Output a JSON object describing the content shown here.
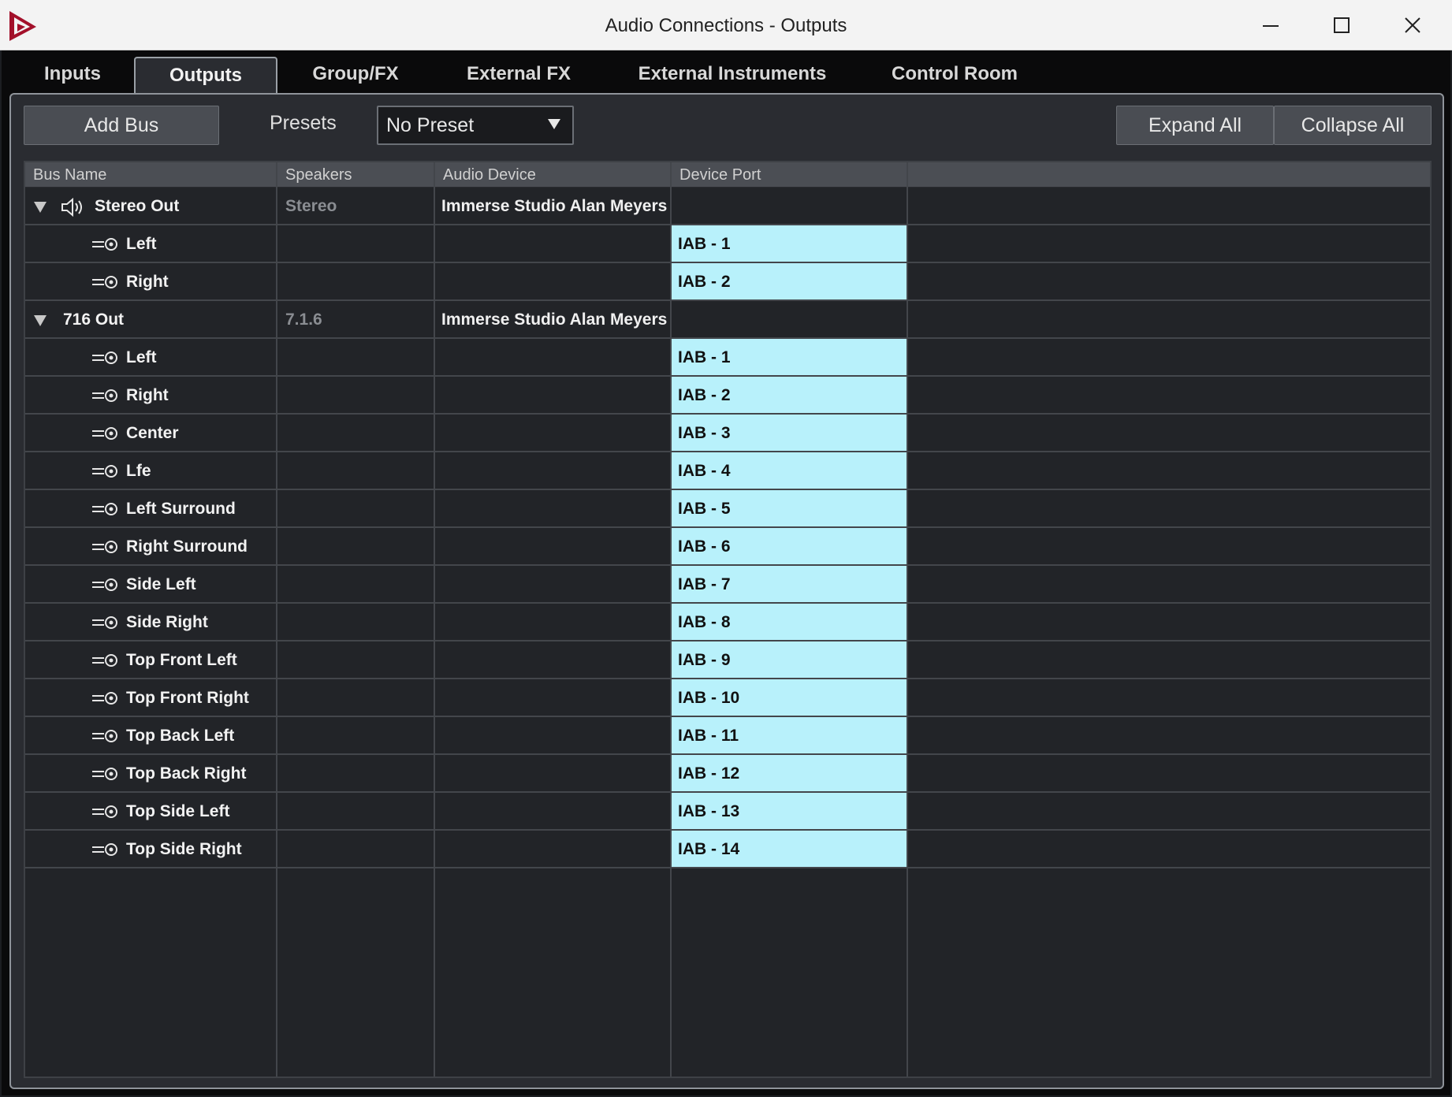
{
  "window": {
    "title": "Audio Connections - Outputs"
  },
  "tabs": [
    {
      "label": "Inputs"
    },
    {
      "label": "Outputs"
    },
    {
      "label": "Group/FX"
    },
    {
      "label": "External FX"
    },
    {
      "label": "External Instruments"
    },
    {
      "label": "Control Room"
    }
  ],
  "active_tab": "Outputs",
  "toolbar": {
    "add_bus_label": "Add Bus",
    "presets_label": "Presets",
    "preset_value": "No Preset",
    "expand_all_label": "Expand All",
    "collapse_all_label": "Collapse All"
  },
  "table": {
    "columns": [
      "Bus Name",
      "Speakers",
      "Audio Device",
      "Device Port"
    ],
    "rows": [
      {
        "type": "bus",
        "name": "Stereo Out",
        "speakers": "Stereo",
        "device": "Immerse Studio Alan Meyers",
        "port": "",
        "icon": "speaker-icon"
      },
      {
        "type": "channel",
        "name": "Left",
        "port": "IAB - 1"
      },
      {
        "type": "channel",
        "name": "Right",
        "port": "IAB - 2"
      },
      {
        "type": "bus",
        "name": "716 Out",
        "speakers": "7.1.6",
        "device": "Immerse Studio Alan Meyers",
        "port": ""
      },
      {
        "type": "channel",
        "name": "Left",
        "port": "IAB - 1"
      },
      {
        "type": "channel",
        "name": "Right",
        "port": "IAB - 2"
      },
      {
        "type": "channel",
        "name": "Center",
        "port": "IAB - 3"
      },
      {
        "type": "channel",
        "name": "Lfe",
        "port": "IAB - 4"
      },
      {
        "type": "channel",
        "name": "Left Surround",
        "port": "IAB - 5"
      },
      {
        "type": "channel",
        "name": "Right Surround",
        "port": "IAB - 6"
      },
      {
        "type": "channel",
        "name": "Side Left",
        "port": "IAB - 7"
      },
      {
        "type": "channel",
        "name": "Side Right",
        "port": "IAB - 8"
      },
      {
        "type": "channel",
        "name": "Top Front Left",
        "port": "IAB - 9"
      },
      {
        "type": "channel",
        "name": "Top Front Right",
        "port": "IAB - 10"
      },
      {
        "type": "channel",
        "name": "Top Back Left",
        "port": "IAB - 11"
      },
      {
        "type": "channel",
        "name": "Top Back Right",
        "port": "IAB - 12"
      },
      {
        "type": "channel",
        "name": "Top Side Left",
        "port": "IAB - 13"
      },
      {
        "type": "channel",
        "name": "Top Side Right",
        "port": "IAB - 14"
      }
    ]
  },
  "colors": {
    "assigned_port": "#b8f1fb",
    "background": "#222428",
    "logo": "#a3102a"
  }
}
